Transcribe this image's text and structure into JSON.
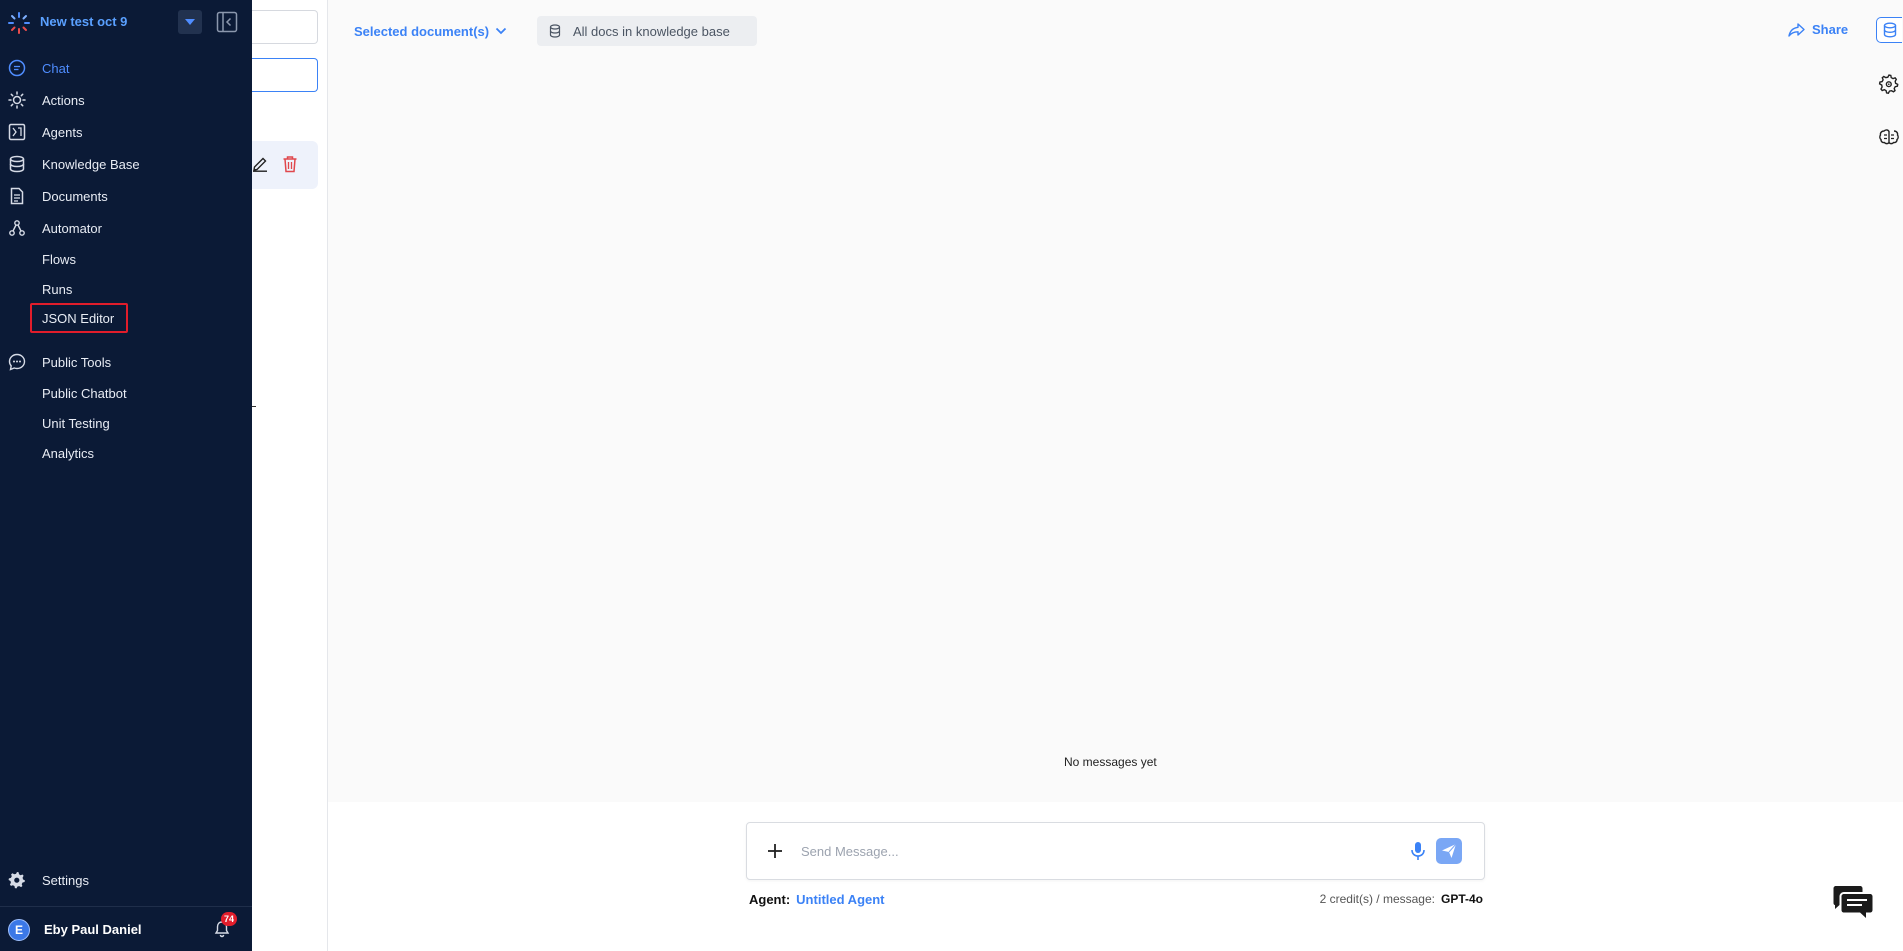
{
  "workspace": {
    "name": "New test oct 9"
  },
  "sidebar": {
    "items": [
      {
        "label": "Chat",
        "icon": "chat-icon",
        "active": true
      },
      {
        "label": "Actions",
        "icon": "sun-icon"
      },
      {
        "label": "Agents",
        "icon": "agents-icon"
      },
      {
        "label": "Knowledge Base",
        "icon": "database-icon"
      },
      {
        "label": "Documents",
        "icon": "document-icon"
      },
      {
        "label": "Automator",
        "icon": "automator-icon"
      }
    ],
    "automator_sub": [
      {
        "label": "Flows"
      },
      {
        "label": "Runs"
      },
      {
        "label": "JSON Editor"
      }
    ],
    "public_tools": {
      "label": "Public Tools",
      "icon": "chat-dots-icon"
    },
    "public_sub": [
      {
        "label": "Public Chatbot"
      },
      {
        "label": "Unit Testing"
      },
      {
        "label": "Analytics"
      }
    ],
    "settings": {
      "label": "Settings",
      "icon": "gear-icon"
    },
    "user": {
      "name": "Eby Paul Daniel",
      "initial": "E",
      "notifications": "74"
    }
  },
  "topbar": {
    "doc_select": "Selected document(s)",
    "kb_scope": "All docs in knowledge base",
    "share": "Share"
  },
  "chat": {
    "empty_text": "No messages yet",
    "placeholder": "Send Message...",
    "agent_label": "Agent:",
    "agent_name": "Untitled Agent",
    "credits": "2 credit(s) / message:",
    "model": "GPT-4o"
  },
  "colors": {
    "sidebar_bg": "#0b1a36",
    "accent": "#3b82f6",
    "highlight_border": "#e11d2b"
  }
}
